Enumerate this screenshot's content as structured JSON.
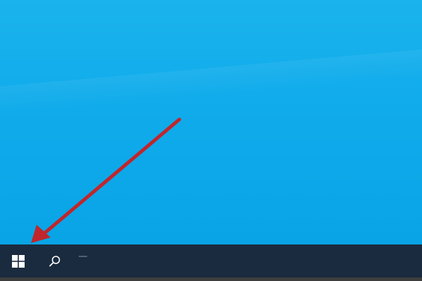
{
  "screen": {
    "desktop_color": "#10abeb",
    "taskbar_color": "#1a2b3f",
    "annotation_color": "#c0262c"
  },
  "taskbar": {
    "start_button": {
      "icon": "windows-logo-icon"
    },
    "search_button": {
      "icon": "search-icon"
    }
  }
}
